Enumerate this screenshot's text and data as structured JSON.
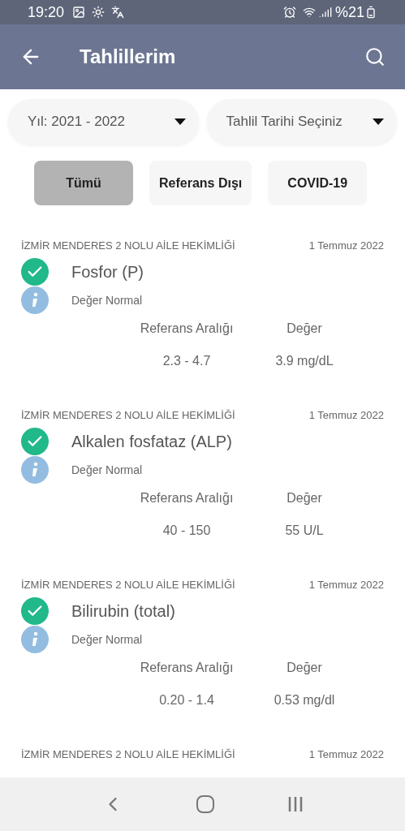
{
  "status_bar": {
    "time": "19:20",
    "battery": "%21"
  },
  "header": {
    "title": "Tahlillerim"
  },
  "filters": [
    {
      "value": "Yıl: 2021 - 2022"
    },
    {
      "value": "Tahlil Tarihi Seçiniz"
    }
  ],
  "tabs": [
    {
      "label": "Tümü",
      "selected": true
    },
    {
      "label": "Referans Dışı",
      "selected": false
    },
    {
      "label": "COVID-19",
      "selected": false
    }
  ],
  "results": [
    {
      "lab": "İZMİR MENDERES 2 NOLU AİLE HEKİMLİĞİ",
      "date": "1 Temmuz 2022",
      "test": "Fosfor (P)",
      "normal": true,
      "status": "Değer Normal",
      "range_label": "Referans Aralığı",
      "value_label": "Değer",
      "range": "2.3 - 4.7",
      "value": "3.9 mg/dL"
    },
    {
      "lab": "İZMİR MENDERES 2 NOLU AİLE HEKİMLİĞİ",
      "date": "1 Temmuz 2022",
      "test": "Alkalen fosfataz (ALP)",
      "normal": true,
      "status": "Değer Normal",
      "range_label": "Referans Aralığı",
      "value_label": "Değer",
      "range": "40 - 150",
      "value": "55 U/L"
    },
    {
      "lab": "İZMİR MENDERES 2 NOLU AİLE HEKİMLİĞİ",
      "date": "1 Temmuz 2022",
      "test": "Bilirubin (total)",
      "normal": true,
      "status": "Değer Normal",
      "range_label": "Referans Aralığı",
      "value_label": "Değer",
      "range": "0.20 - 1.4",
      "value": "0.53 mg/dl"
    },
    {
      "lab": "İZMİR MENDERES 2 NOLU AİLE HEKİMLİĞİ",
      "date": "1 Temmuz 2022"
    }
  ]
}
